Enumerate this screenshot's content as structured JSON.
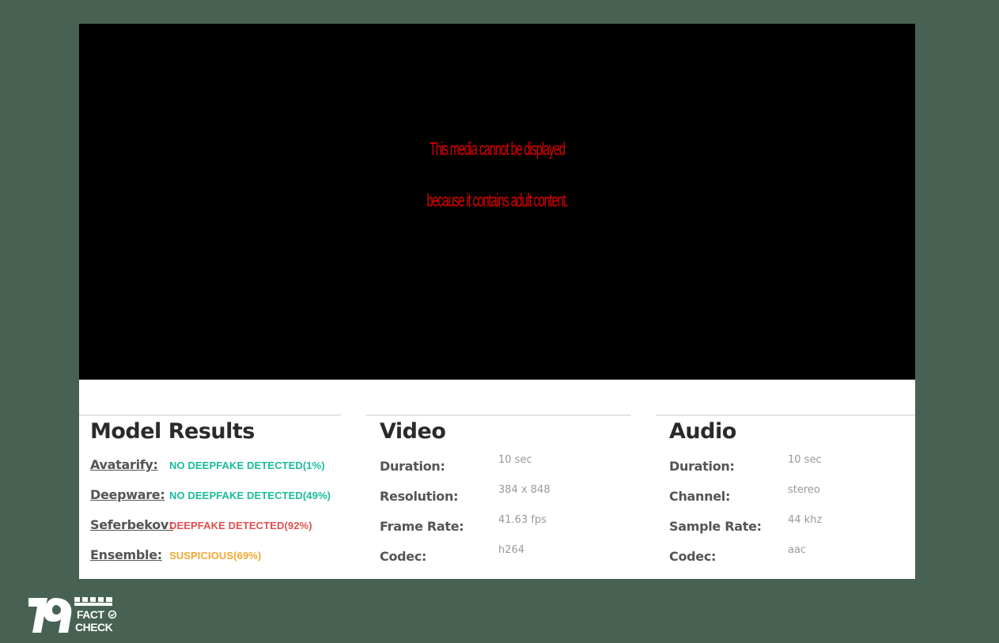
{
  "media": {
    "message_line1": "This media cannot be displayed",
    "message_line2": "because it contains adult content."
  },
  "model_results": {
    "title": "Model Results",
    "items": [
      {
        "name": "Avatarify:",
        "status": "NO DEEPFAKE DETECTED(1%)",
        "color": "#1abc9c"
      },
      {
        "name": "Deepware:",
        "status": "NO DEEPFAKE DETECTED(49%)",
        "color": "#1abc9c"
      },
      {
        "name": "Seferbekov:",
        "status": "DEEPFAKE DETECTED(92%)",
        "color": "#e05050"
      },
      {
        "name": "Ensemble:",
        "status": "SUSPICIOUS(69%)",
        "color": "#f0a830"
      }
    ]
  },
  "video": {
    "title": "Video",
    "rows": [
      {
        "label": "Duration:",
        "value": "10 sec"
      },
      {
        "label": "Resolution:",
        "value": "384 x 848"
      },
      {
        "label": "Frame Rate:",
        "value": "41.63 fps"
      },
      {
        "label": "Codec:",
        "value": "h264"
      }
    ]
  },
  "audio": {
    "title": "Audio",
    "rows": [
      {
        "label": "Duration:",
        "value": "10 sec"
      },
      {
        "label": "Channel:",
        "value": "stereo"
      },
      {
        "label": "Sample Rate:",
        "value": "44 khz"
      },
      {
        "label": "Codec:",
        "value": "aac"
      }
    ]
  },
  "logo": {
    "text_line1": "FACT",
    "text_line2": "CHECK"
  },
  "colors": {
    "page_background": "#476253",
    "media_background": "#000000",
    "media_message": "#e00000",
    "no_deepfake": "#1abc9c",
    "deepfake": "#e05050",
    "suspicious": "#f0a830"
  }
}
